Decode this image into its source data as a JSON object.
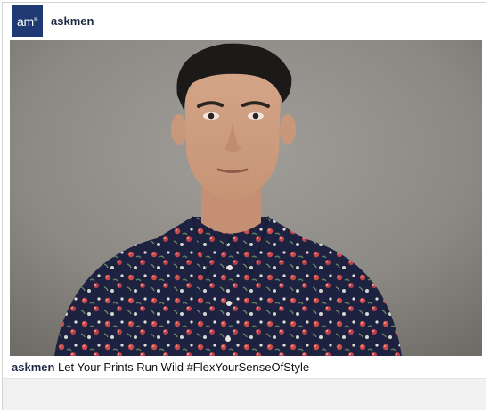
{
  "post": {
    "avatar_text": "am",
    "avatar_mark": "®",
    "handle": "askmen",
    "caption_handle": "askmen",
    "caption_text": "Let Your Prints Run Wild #FlexYourSenseOfStyle"
  },
  "colors": {
    "avatar_bg": "#1f3a73",
    "handle": "#1b2a44",
    "shirt": "#1c2240",
    "flowers": "#c94a4a"
  },
  "icons": {
    "avatar": "askmen-logo-icon"
  }
}
